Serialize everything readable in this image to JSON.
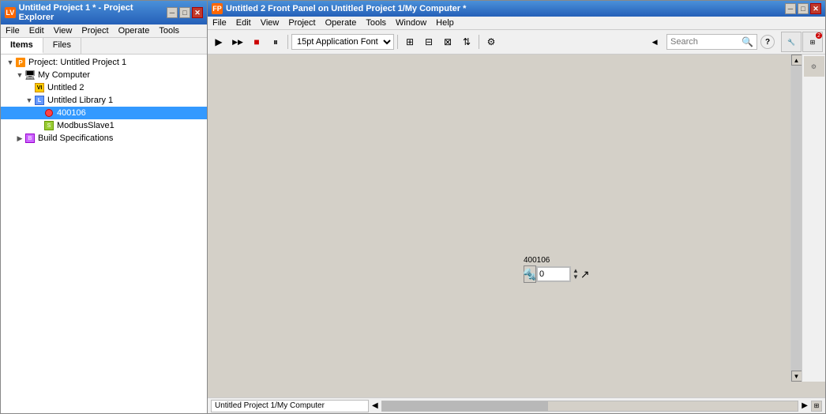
{
  "project_explorer": {
    "title": "Untitled Project 1 * - Project Explorer",
    "icon": "LV",
    "menus": [
      "File",
      "Edit",
      "View",
      "Project",
      "Operate",
      "Tools"
    ],
    "tabs": [
      "Items",
      "Files"
    ],
    "active_tab": "Items",
    "tree": [
      {
        "id": "project-root",
        "label": "Project: Untitled Project 1",
        "level": 0,
        "icon": "project",
        "expanded": true
      },
      {
        "id": "my-computer",
        "label": "My Computer",
        "level": 1,
        "icon": "computer",
        "expanded": true
      },
      {
        "id": "untitled2",
        "label": "Untitled 2",
        "level": 2,
        "icon": "vi"
      },
      {
        "id": "untitled-library",
        "label": "Untitled Library 1",
        "level": 2,
        "icon": "library",
        "expanded": true
      },
      {
        "id": "item-400106",
        "label": "400106",
        "level": 3,
        "icon": "var",
        "selected": true
      },
      {
        "id": "modbus-slave",
        "label": "ModbusSlave1",
        "level": 3,
        "icon": "slave"
      },
      {
        "id": "build-specs",
        "label": "Build Specifications",
        "level": 1,
        "icon": "build"
      }
    ]
  },
  "vi_window": {
    "title": "Untitled 2 Front Panel on Untitled Project 1/My Computer *",
    "menus": [
      "File",
      "Edit",
      "View",
      "Project",
      "Operate",
      "Tools",
      "Window",
      "Help"
    ],
    "toolbar": {
      "font_label": "15pt Application Font",
      "search_placeholder": "Search"
    },
    "panel": {
      "control_label": "400106",
      "control_value": "0"
    },
    "statusbar": {
      "path": "Untitled Project 1/My Computer"
    }
  },
  "icons": {
    "run": "▶",
    "run_continuously": "▷▷",
    "abort": "■",
    "pause": "⏸",
    "arrow_left": "◀",
    "arrow_right": "▶",
    "arrow_up": "▲",
    "arrow_down": "▼",
    "search": "🔍",
    "help": "?",
    "settings_icon": "⚙",
    "align": "⊞",
    "distribute": "⊟",
    "resize": "⊠",
    "reorder": "⇅",
    "close": "✕",
    "minimize": "─",
    "maximize": "□"
  }
}
